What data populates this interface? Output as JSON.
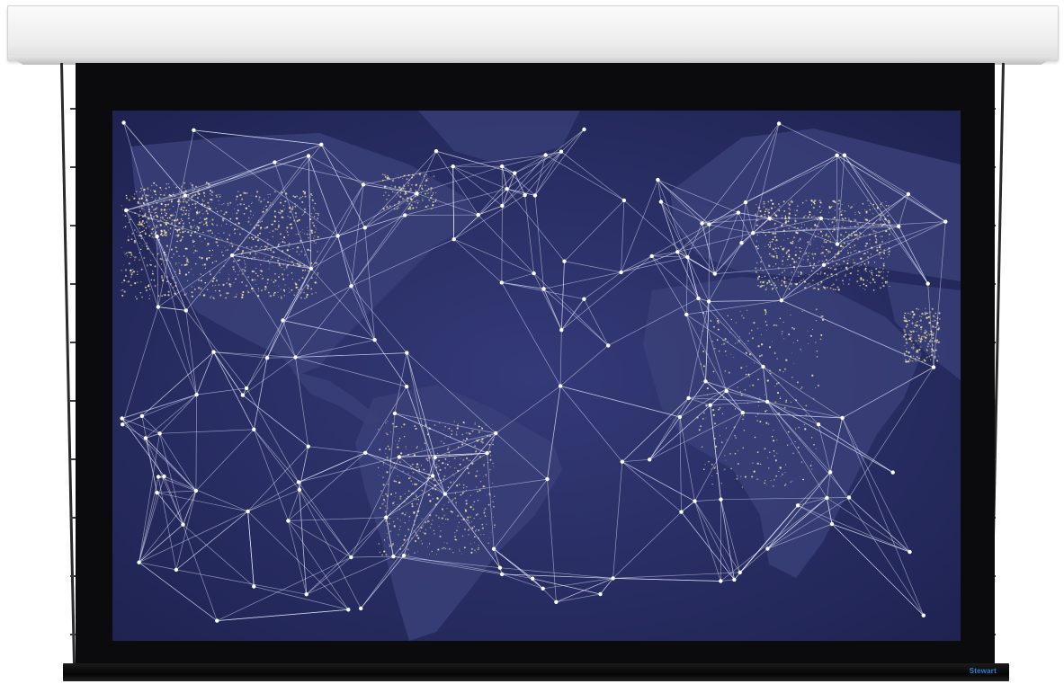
{
  "brand": {
    "logo_text": "Stewart"
  },
  "colors": {
    "housing": "#eeeeee",
    "screen_border": "#0b0b0d",
    "map_ocean": "#2a2f66",
    "land": "#3b4178",
    "network_line": "#e6e9ff",
    "city_lights": "#f2e6a6"
  },
  "image": {
    "subject": "projector-screen-world-map-network"
  }
}
